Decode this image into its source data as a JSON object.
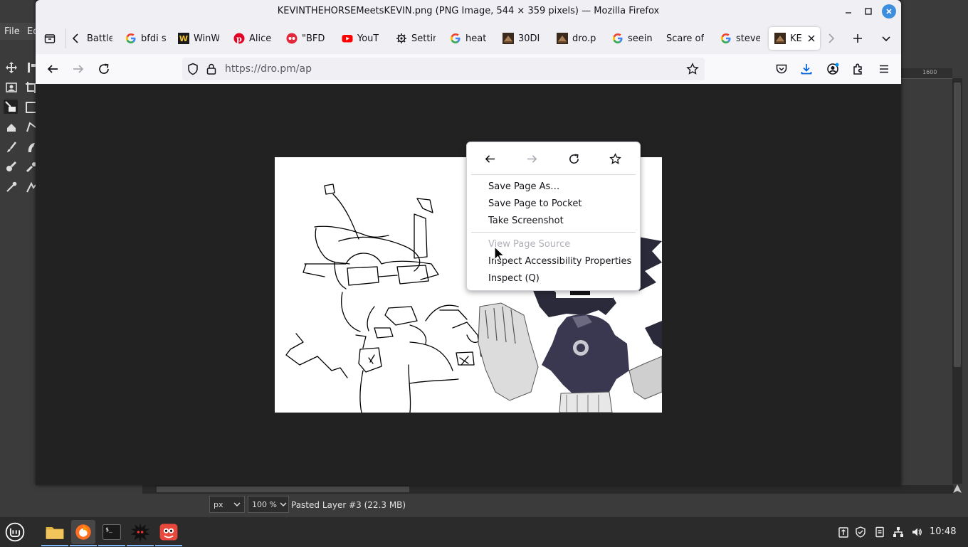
{
  "gimp": {
    "menu": [
      "File",
      "Ed"
    ],
    "ruler_label": "1600",
    "unit": "px",
    "zoom": "100 %",
    "status": "Pasted Layer #3 (22.3 MB)"
  },
  "window": {
    "title": "KEVINTHEHORSEMeetsKEVIN.png (PNG Image, 544 × 359 pixels) — Mozilla Firefox"
  },
  "tabs": [
    {
      "label": "Battle",
      "icon": "battle-icon"
    },
    {
      "label": "bfdi s",
      "icon": "google-icon"
    },
    {
      "label": "WinW",
      "icon": "w-logo-icon"
    },
    {
      "label": "Alice",
      "icon": "pinterest-icon"
    },
    {
      "label": "\"BFD",
      "icon": "red-dots-icon"
    },
    {
      "label": "YouT",
      "icon": "youtube-icon"
    },
    {
      "label": "Settin",
      "icon": "gear-icon"
    },
    {
      "label": "heat",
      "icon": "google-icon"
    },
    {
      "label": "30DI",
      "icon": "dro-icon"
    },
    {
      "label": "dro.p",
      "icon": "dro-icon"
    },
    {
      "label": "seein",
      "icon": "google-icon"
    },
    {
      "label": "Scare of",
      "icon": "none"
    },
    {
      "label": "steve",
      "icon": "google-icon"
    },
    {
      "label": "KE",
      "icon": "dro-icon",
      "selected": true
    }
  ],
  "urlbar": {
    "url": "https://dro.pm/ap"
  },
  "context_menu": {
    "items": [
      {
        "label": "Save Page As…",
        "enabled": true
      },
      {
        "label": "Save Page to Pocket",
        "enabled": true
      },
      {
        "label": "Take Screenshot",
        "enabled": true
      },
      {
        "label": "View Page Source",
        "enabled": false
      },
      {
        "label": "Inspect Accessibility Properties",
        "enabled": true
      },
      {
        "label": "Inspect (Q)",
        "enabled": true
      }
    ]
  },
  "taskbar": {
    "clock": "10:48"
  },
  "colors": {
    "accent": "#3e8ede",
    "content_bg": "#222222",
    "chrome_bg": "#f0f0f4"
  }
}
